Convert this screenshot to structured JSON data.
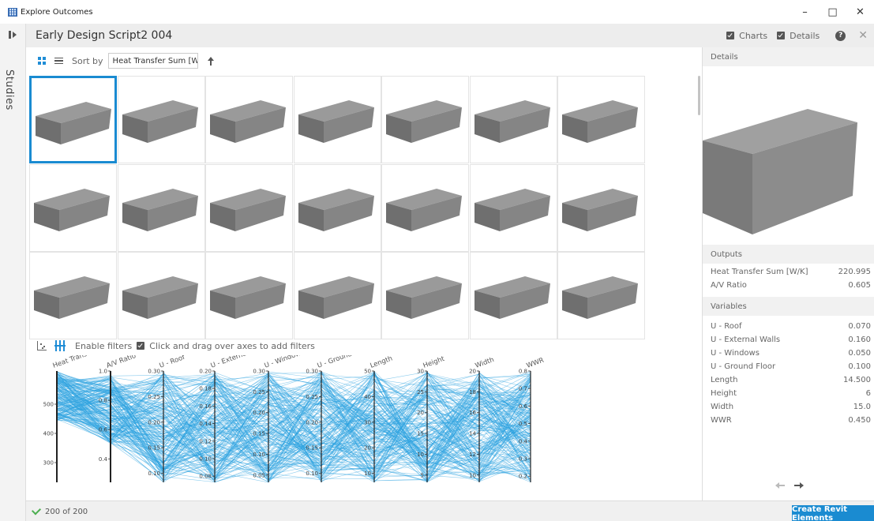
{
  "window": {
    "title": "Explore Outcomes",
    "minimize": "–",
    "maximize": "□",
    "close": "✕"
  },
  "sidebar": {
    "label": "Studies"
  },
  "header": {
    "study_title": "Early Design Script2 004",
    "charts_label": "Charts",
    "details_label": "Details",
    "help": "?",
    "close": "✕"
  },
  "toolbar": {
    "sort_label": "Sort by",
    "sort_value": "Heat Transfer Sum [W/K]"
  },
  "filterbar": {
    "enable_filters_label": "Enable filters",
    "hint": "Click and drag over axes to add filters"
  },
  "status": {
    "count_text": "200 of 200"
  },
  "actions": {
    "create_label": "Create Revit Elements"
  },
  "details": {
    "header": "Details",
    "outputs_header": "Outputs",
    "outputs": [
      {
        "label": "Heat Transfer Sum [W/K]",
        "value": "220.995"
      },
      {
        "label": "A/V Ratio",
        "value": "0.605"
      }
    ],
    "variables_header": "Variables",
    "variables": [
      {
        "label": "U - Roof",
        "value": "0.070"
      },
      {
        "label": "U - External Walls",
        "value": "0.160"
      },
      {
        "label": "U - Windows",
        "value": "0.050"
      },
      {
        "label": "U - Ground Floor",
        "value": "0.100"
      },
      {
        "label": "Length",
        "value": "14.500"
      },
      {
        "label": "Height",
        "value": "6"
      },
      {
        "label": "Width",
        "value": "15.0"
      },
      {
        "label": "WWR",
        "value": "0.450"
      }
    ]
  },
  "grid": {
    "columns": 7,
    "rows": 3,
    "selected_index": 0
  },
  "colors": {
    "accent": "#1a8bd1",
    "line": "#2ca3e0",
    "box_top": "#9a9a9a",
    "box_front": "#6f6f6f",
    "box_side": "#858585"
  },
  "chart_data": {
    "type": "parallel-coordinates",
    "records": 200,
    "axes": [
      {
        "name": "Heat Transfer Sum...",
        "ticks": [
          "500",
          "400",
          "300"
        ],
        "range": [
          230,
          580
        ]
      },
      {
        "name": "A/V Ratio",
        "ticks": [
          "1.0",
          "0.8",
          "0.6",
          "0.4"
        ],
        "range": [
          0.3,
          1.0
        ]
      },
      {
        "name": "U - Roof",
        "ticks": [
          "0.30",
          "0.25",
          "0.20",
          "0.15",
          "0.10"
        ],
        "range": [
          0.05,
          0.3
        ]
      },
      {
        "name": "U - External Walls",
        "ticks": [
          "0.20",
          "0.18",
          "0.16",
          "0.14",
          "0.12",
          "0.10",
          "0.08"
        ],
        "range": [
          0.08,
          0.2
        ]
      },
      {
        "name": "U - Windows",
        "ticks": [
          "0.30",
          "0.25",
          "0.20",
          "0.15",
          "0.10",
          "0.05"
        ],
        "range": [
          0.05,
          0.3
        ]
      },
      {
        "name": "U - Ground Floor",
        "ticks": [
          "0.30",
          "0.25",
          "0.20",
          "0.15",
          "0.10"
        ],
        "range": [
          0.1,
          0.3
        ]
      },
      {
        "name": "Length",
        "ticks": [
          "50",
          "40",
          "30",
          "20",
          "10"
        ],
        "range": [
          10,
          50
        ]
      },
      {
        "name": "Height",
        "ticks": [
          "30",
          "25",
          "20",
          "15",
          "10",
          "5"
        ],
        "range": [
          5,
          30
        ]
      },
      {
        "name": "Width",
        "ticks": [
          "20",
          "18",
          "16",
          "14",
          "12",
          "10"
        ],
        "range": [
          10,
          20
        ]
      },
      {
        "name": "WWR",
        "ticks": [
          "0.8",
          "0.7",
          "0.6",
          "0.5",
          "0.4",
          "0.3",
          "0.2"
        ],
        "range": [
          0.2,
          0.8
        ]
      }
    ]
  }
}
